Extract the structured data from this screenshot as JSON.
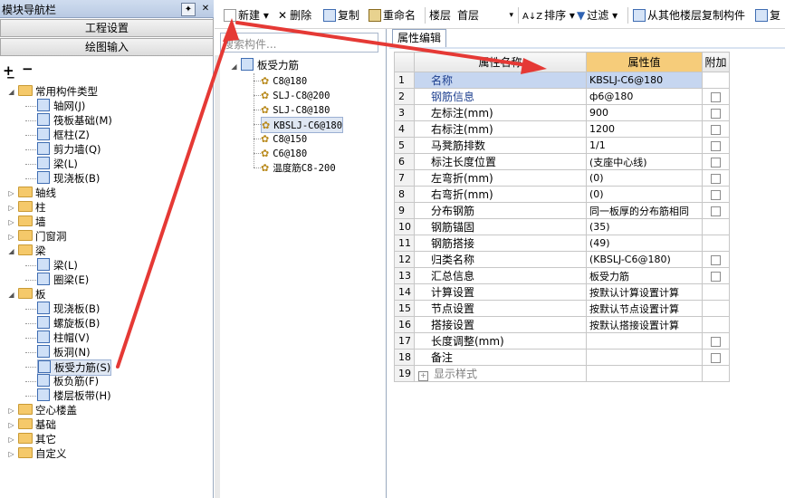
{
  "nav": {
    "title": "模块导航栏",
    "pin": "✦",
    "close": "✕",
    "section1": "工程设置",
    "section2": "绘图输入",
    "tree": [
      {
        "label": "常用构件类型",
        "level": 0,
        "kind": "folder",
        "expanded": true
      },
      {
        "label": "轴网(J)",
        "level": 1,
        "kind": "item"
      },
      {
        "label": "筏板基础(M)",
        "level": 1,
        "kind": "item"
      },
      {
        "label": "框柱(Z)",
        "level": 1,
        "kind": "item"
      },
      {
        "label": "剪力墙(Q)",
        "level": 1,
        "kind": "item"
      },
      {
        "label": "梁(L)",
        "level": 1,
        "kind": "item"
      },
      {
        "label": "现浇板(B)",
        "level": 1,
        "kind": "item"
      },
      {
        "label": "轴线",
        "level": 0,
        "kind": "folder",
        "expanded": false
      },
      {
        "label": "柱",
        "level": 0,
        "kind": "folder",
        "expanded": false
      },
      {
        "label": "墙",
        "level": 0,
        "kind": "folder",
        "expanded": false
      },
      {
        "label": "门窗洞",
        "level": 0,
        "kind": "folder",
        "expanded": false
      },
      {
        "label": "梁",
        "level": 0,
        "kind": "folder",
        "expanded": true
      },
      {
        "label": "梁(L)",
        "level": 1,
        "kind": "item"
      },
      {
        "label": "圈梁(E)",
        "level": 1,
        "kind": "item"
      },
      {
        "label": "板",
        "level": 0,
        "kind": "folder",
        "expanded": true
      },
      {
        "label": "现浇板(B)",
        "level": 1,
        "kind": "item"
      },
      {
        "label": "螺旋板(B)",
        "level": 1,
        "kind": "item"
      },
      {
        "label": "柱帽(V)",
        "level": 1,
        "kind": "item"
      },
      {
        "label": "板洞(N)",
        "level": 1,
        "kind": "item"
      },
      {
        "label": "板受力筋(S)",
        "level": 1,
        "kind": "item",
        "selected": true
      },
      {
        "label": "板负筋(F)",
        "level": 1,
        "kind": "item"
      },
      {
        "label": "楼层板带(H)",
        "level": 1,
        "kind": "item"
      },
      {
        "label": "空心楼盖",
        "level": 0,
        "kind": "folder",
        "expanded": false
      },
      {
        "label": "基础",
        "level": 0,
        "kind": "folder",
        "expanded": false
      },
      {
        "label": "其它",
        "level": 0,
        "kind": "folder",
        "expanded": false
      },
      {
        "label": "自定义",
        "level": 0,
        "kind": "folder",
        "expanded": false
      }
    ]
  },
  "toolbar": {
    "new": "新建",
    "delete": "删除",
    "copy": "复制",
    "rename": "重命名",
    "floor_label": "楼层",
    "floor_value": "首层",
    "sort": "排序",
    "filter": "过滤",
    "copy_from": "从其他楼层复制构件",
    "copy_more": "复"
  },
  "components": {
    "placeholder": "搜索构件...",
    "root": "板受力筋",
    "items": [
      "C8@180",
      "SLJ-C8@200",
      "SLJ-C8@180",
      "KBSLJ-C6@180",
      "C8@150",
      "C6@180",
      "温度筋C8-200"
    ],
    "selected_index": 3
  },
  "props": {
    "tab": "属性编辑",
    "col_name": "属性名称",
    "col_value": "属性值",
    "col_add": "附加",
    "rows": [
      {
        "n": "1",
        "name": "名称",
        "value": "KBSLJ-C6@180",
        "chk": false,
        "blue": true,
        "selected": true
      },
      {
        "n": "2",
        "name": "钢筋信息",
        "value": "ф6@180",
        "chk": true,
        "blue": true
      },
      {
        "n": "3",
        "name": "左标注(mm)",
        "value": "900",
        "chk": true
      },
      {
        "n": "4",
        "name": "右标注(mm)",
        "value": "1200",
        "chk": true
      },
      {
        "n": "5",
        "name": "马凳筋排数",
        "value": "1/1",
        "chk": true
      },
      {
        "n": "6",
        "name": "标注长度位置",
        "value": "(支座中心线)",
        "chk": true
      },
      {
        "n": "7",
        "name": "左弯折(mm)",
        "value": "(0)",
        "chk": true
      },
      {
        "n": "8",
        "name": "右弯折(mm)",
        "value": "(0)",
        "chk": true
      },
      {
        "n": "9",
        "name": "分布钢筋",
        "value": "同一板厚的分布筋相同",
        "chk": true
      },
      {
        "n": "10",
        "name": "钢筋锚固",
        "value": "(35)",
        "chk": false
      },
      {
        "n": "11",
        "name": "钢筋搭接",
        "value": "(49)",
        "chk": false
      },
      {
        "n": "12",
        "name": "归类名称",
        "value": "(KBSLJ-C6@180)",
        "chk": true
      },
      {
        "n": "13",
        "name": "汇总信息",
        "value": "板受力筋",
        "chk": true
      },
      {
        "n": "14",
        "name": "计算设置",
        "value": "按默认计算设置计算",
        "chk": false
      },
      {
        "n": "15",
        "name": "节点设置",
        "value": "按默认节点设置计算",
        "chk": false
      },
      {
        "n": "16",
        "name": "搭接设置",
        "value": "按默认搭接设置计算",
        "chk": false
      },
      {
        "n": "17",
        "name": "长度调整(mm)",
        "value": "",
        "chk": true
      },
      {
        "n": "18",
        "name": "备注",
        "value": "",
        "chk": true
      },
      {
        "n": "19",
        "name": "显示样式",
        "value": "",
        "chk": false,
        "group": true
      }
    ]
  }
}
